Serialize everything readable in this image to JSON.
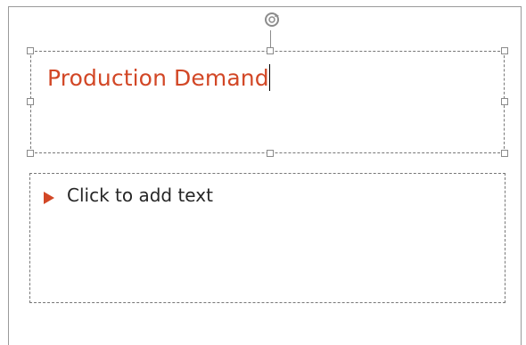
{
  "slide": {
    "title_text": "Production Demand",
    "content_placeholder": "Click to add text"
  },
  "icons": {
    "rotate": "rotate-handle-icon",
    "bullet": "triangle-bullet-icon"
  },
  "colors": {
    "title": "#d24726",
    "bullet": "#d24726",
    "body_text": "#262626",
    "frame_border": "#777777"
  }
}
